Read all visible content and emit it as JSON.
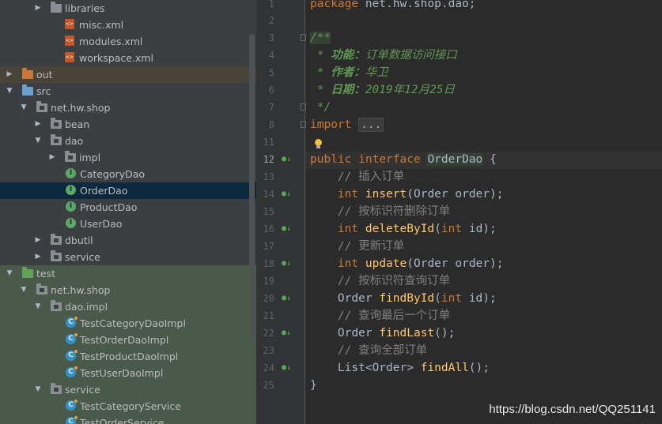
{
  "project_tree": {
    "items": [
      {
        "label": "libraries",
        "icon": "folder-icon",
        "depth": 2,
        "arrow": "▶"
      },
      {
        "label": "misc.xml",
        "icon": "xml-file-icon",
        "depth": 3,
        "arrow": ""
      },
      {
        "label": "modules.xml",
        "icon": "xml-file-icon",
        "depth": 3,
        "arrow": ""
      },
      {
        "label": "workspace.xml",
        "icon": "xml-file-icon",
        "depth": 3,
        "arrow": ""
      },
      {
        "label": "out",
        "icon": "folder-orange-icon",
        "depth": 0,
        "arrow": "▶"
      },
      {
        "label": "src",
        "icon": "folder-blue-icon",
        "depth": 0,
        "arrow": "▼"
      },
      {
        "label": "net.hw.shop",
        "icon": "package-icon",
        "depth": 1,
        "arrow": "▼"
      },
      {
        "label": "bean",
        "icon": "package-icon",
        "depth": 2,
        "arrow": "▶"
      },
      {
        "label": "dao",
        "icon": "package-icon",
        "depth": 2,
        "arrow": "▼"
      },
      {
        "label": "impl",
        "icon": "package-icon",
        "depth": 3,
        "arrow": "▶"
      },
      {
        "label": "CategoryDao",
        "icon": "interface-icon",
        "depth": 4,
        "arrow": ""
      },
      {
        "label": "OrderDao",
        "icon": "interface-icon",
        "depth": 4,
        "arrow": "",
        "selected": true
      },
      {
        "label": "ProductDao",
        "icon": "interface-icon",
        "depth": 4,
        "arrow": ""
      },
      {
        "label": "UserDao",
        "icon": "interface-icon",
        "depth": 4,
        "arrow": ""
      },
      {
        "label": "dbutil",
        "icon": "package-icon",
        "depth": 2,
        "arrow": "▶"
      },
      {
        "label": "service",
        "icon": "package-icon",
        "depth": 2,
        "arrow": "▶"
      },
      {
        "label": "test",
        "icon": "folder-green-icon",
        "depth": 0,
        "arrow": "▼"
      },
      {
        "label": "net.hw.shop",
        "icon": "package-icon",
        "depth": 1,
        "arrow": "▼"
      },
      {
        "label": "dao.impl",
        "icon": "package-icon",
        "depth": 2,
        "arrow": "▼"
      },
      {
        "label": "TestCategoryDaoImpl",
        "icon": "test-class-icon",
        "depth": 4,
        "arrow": ""
      },
      {
        "label": "TestOrderDaoImpl",
        "icon": "test-class-icon",
        "depth": 4,
        "arrow": ""
      },
      {
        "label": "TestProductDaoImpl",
        "icon": "test-class-icon",
        "depth": 4,
        "arrow": ""
      },
      {
        "label": "TestUserDaoImpl",
        "icon": "test-class-icon",
        "depth": 4,
        "arrow": ""
      },
      {
        "label": "service",
        "icon": "package-icon",
        "depth": 2,
        "arrow": "▼"
      },
      {
        "label": "TestCategoryService",
        "icon": "test-class-icon",
        "depth": 4,
        "arrow": ""
      },
      {
        "label": "TestOrderService",
        "icon": "test-class-icon",
        "depth": 4,
        "arrow": ""
      }
    ]
  },
  "gutter": {
    "line_numbers": [
      "1",
      "2",
      "3",
      "4",
      "5",
      "6",
      "7",
      "8",
      "11",
      "12",
      "13",
      "14",
      "15",
      "16",
      "17",
      "18",
      "19",
      "20",
      "21",
      "22",
      "23",
      "24",
      "25"
    ],
    "current_line": "12"
  },
  "code": {
    "l1": {
      "kw": "package",
      "rest": " net.hw.shop.dao;"
    },
    "l3": {
      "doc": "/**"
    },
    "l4": {
      "star": " * ",
      "tag": "功能：",
      "text": "订单数据访问接口"
    },
    "l5": {
      "star": " * ",
      "tag": "作者：",
      "text": "华卫"
    },
    "l6": {
      "star": " * ",
      "tag": "日期：",
      "text": "2019年12月25日"
    },
    "l7": {
      "doc": " */"
    },
    "l8": {
      "kw": "import",
      "space": " ",
      "fold": "..."
    },
    "l12": {
      "kw1": "public",
      "kw2": "interface",
      "name": "OrderDao",
      "brace": " {"
    },
    "l13": {
      "cmt": "    // 插入订单"
    },
    "l14": {
      "type": "int",
      "fn": "insert",
      "args": "(Order order);"
    },
    "l15": {
      "cmt": "    // 按标识符删除订单"
    },
    "l16": {
      "type": "int",
      "fn": "deleteById",
      "args_open": "(",
      "argtype": "int",
      "args_close": " id);"
    },
    "l17": {
      "cmt": "    // 更新订单"
    },
    "l18": {
      "type": "int",
      "fn": "update",
      "args": "(Order order);"
    },
    "l19": {
      "cmt": "    // 按标识符查询订单"
    },
    "l20": {
      "ret": "Order",
      "fn": "findById",
      "args_open": "(",
      "argtype": "int",
      "args_close": " id);"
    },
    "l21": {
      "cmt": "    // 查询最后一个订单"
    },
    "l22": {
      "ret": "Order",
      "fn": "findLast",
      "args": "();"
    },
    "l23": {
      "cmt": "    // 查询全部订单"
    },
    "l24": {
      "ret": "List<Order>",
      "fn": "findAll",
      "args": "();"
    },
    "l25": {
      "brace": "}"
    }
  },
  "watermark": "https://blog.csdn.net/QQ251141",
  "colors": {
    "keyword": "#cc7832",
    "method": "#ffc66d",
    "comment": "#808080",
    "javadoc": "#629755",
    "text": "#a9b7c6",
    "selection": "#0d293e"
  }
}
